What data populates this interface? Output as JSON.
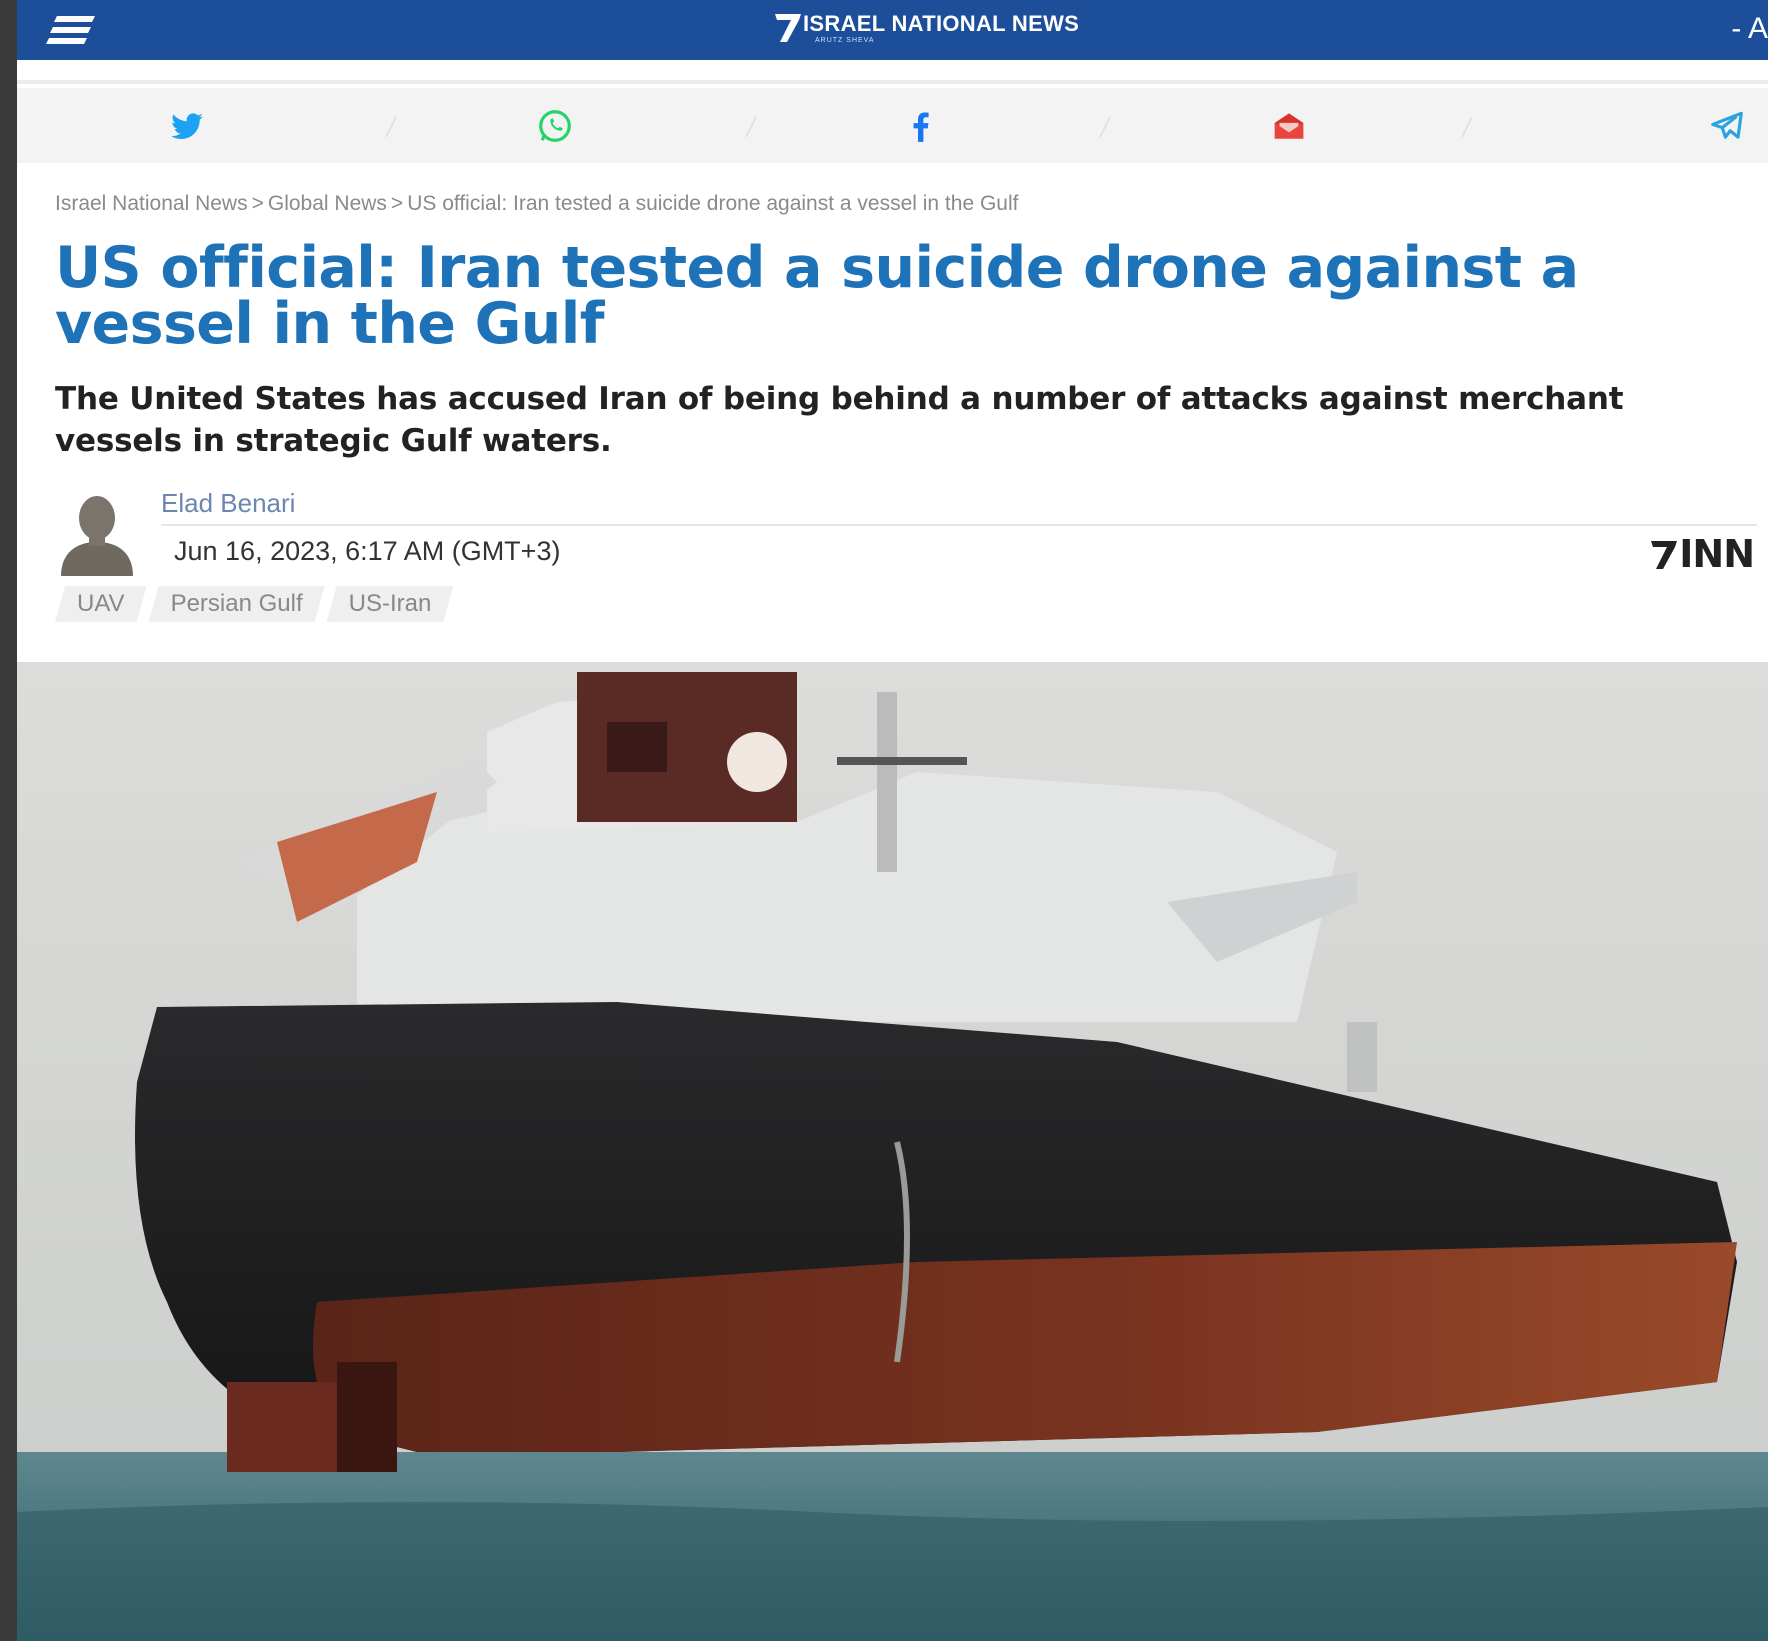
{
  "header": {
    "logo_text": "ISRAEL NATIONAL NEWS",
    "logo_sub": "ARUTZ SHEVA",
    "right_text": "- A",
    "menu_icon": "hamburger-icon",
    "brand_color": "#1c4e99"
  },
  "share": [
    {
      "name": "twitter",
      "icon": "twitter-icon",
      "color": "#1da1f2"
    },
    {
      "name": "whatsapp",
      "icon": "whatsapp-icon",
      "color": "#25d366"
    },
    {
      "name": "facebook",
      "icon": "facebook-icon",
      "color": "#1877f2"
    },
    {
      "name": "email",
      "icon": "email-icon",
      "color": "#d9342b"
    },
    {
      "name": "telegram",
      "icon": "telegram-icon",
      "color": "#2aa3e0"
    }
  ],
  "breadcrumb": {
    "items": [
      "Israel National News",
      "Global News",
      "US official: Iran tested a suicide drone against a vessel in the Gulf"
    ],
    "separator": ">"
  },
  "article": {
    "headline": "US official: Iran tested a suicide drone against a vessel in the Gulf",
    "subheadline": "The United States has accused Iran of being behind a number of attacks against merchant vessels in strategic Gulf waters.",
    "author": "Elad Benari",
    "date": "Jun 16, 2023, 6:17 AM (GMT+3)",
    "source_logo": "INN",
    "tags": [
      "UAV",
      "Persian Gulf",
      "US-Iran"
    ],
    "headline_color": "#1d72b8"
  }
}
